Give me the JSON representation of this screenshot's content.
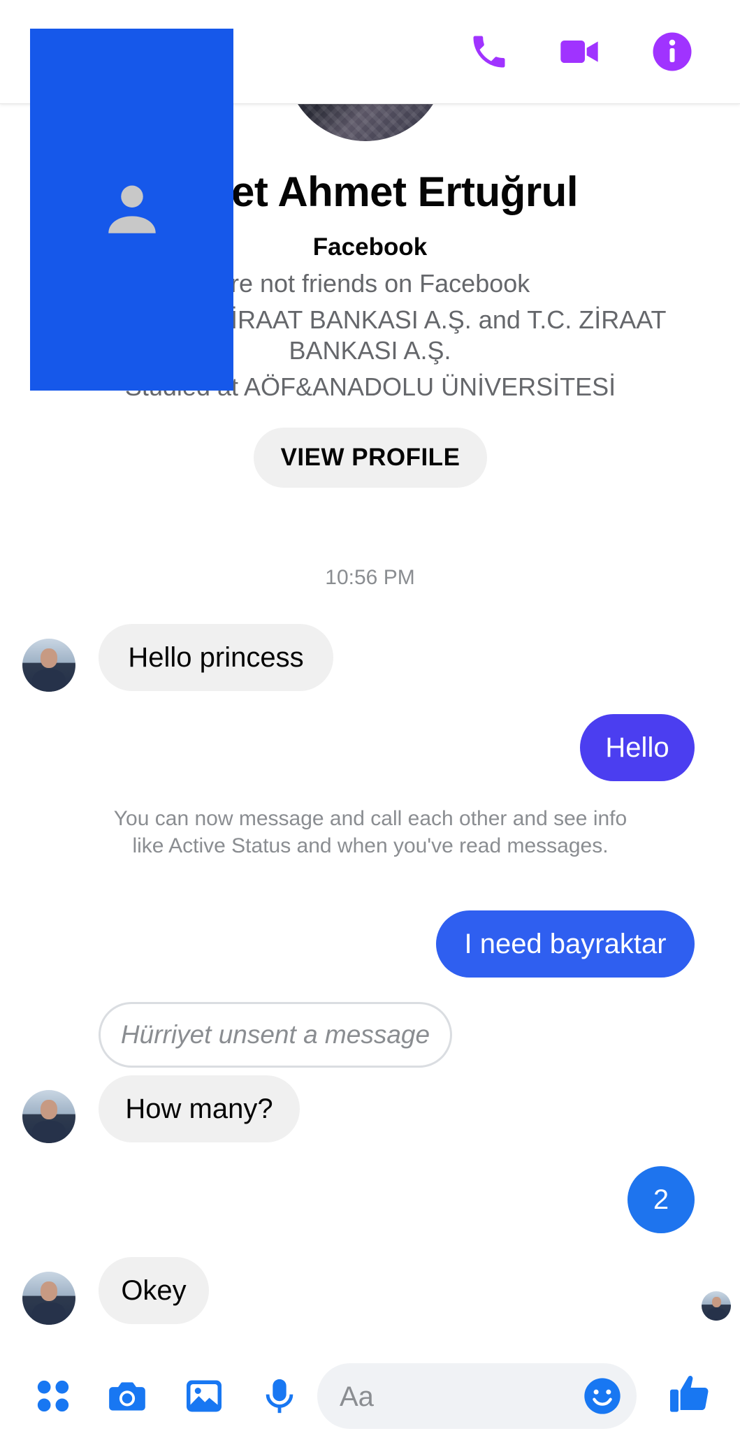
{
  "header": {
    "icons": [
      "phone-icon",
      "video-camera-icon",
      "info-icon"
    ]
  },
  "profile": {
    "name": "Hürriyet Ahmet Ertuğrul",
    "visible_name": "iyet Ahmet Ertuğrul",
    "subtitle": "Facebook",
    "friend_status": "re not friends on Facebook",
    "work": "İRAAT BANKASI A.Ş. and T.C. ZİRAAT",
    "work_line2": "BANKASI A.Ş.",
    "education": "Studied at AÖF&ANADOLU ÜNİVERSİTESİ",
    "view_profile_label": "VIEW PROFILE"
  },
  "thread": {
    "timestamp": "10:56 PM",
    "system_message": "You can now message and call each other and see info like Active Status and when you've read messages.",
    "messages": [
      {
        "sender": "them",
        "text": "Hello princess"
      },
      {
        "sender": "me",
        "text": "Hello"
      },
      {
        "sender": "me",
        "text": "I need bayraktar"
      },
      {
        "sender": "them",
        "text": "Hürriyet unsent a message",
        "unsent": true
      },
      {
        "sender": "them",
        "text": "How many?"
      },
      {
        "sender": "me",
        "text": "2"
      },
      {
        "sender": "them",
        "text": "Okey"
      }
    ]
  },
  "composer": {
    "placeholder": "Aa",
    "icons": [
      "apps-icon",
      "camera-icon",
      "photo-icon",
      "microphone-icon",
      "emoji-icon",
      "thumbs-up-icon"
    ]
  },
  "colors": {
    "accent": "#a033ff",
    "link_blue": "#1877f2",
    "redaction": "#1658ea"
  }
}
